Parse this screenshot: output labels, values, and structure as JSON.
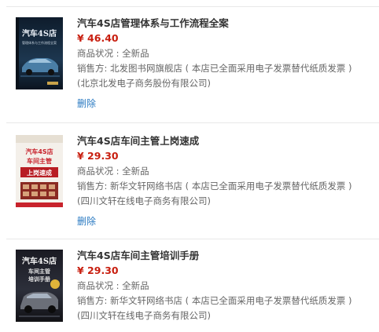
{
  "colors": {
    "price": "#c81e0f",
    "link": "#2a7ac2",
    "title": "#333333",
    "meta": "#666666"
  },
  "items": [
    {
      "cover_icon": "book-cover-car-dark",
      "title": "汽车4S店管理体系与工作流程全案",
      "price": "¥ 46.40",
      "condition": "商品状况 :  全新品",
      "seller_line": "销售方: 北发图书网旗舰店 ( 本店已全面采用电子发票替代纸质发票 )",
      "seller_company": "(北京北发电子商务股份有限公司)",
      "delete_label": "删除",
      "cover_text": {
        "t1": "汽车4S店",
        "t2": "管理体系与工作流程全案"
      }
    },
    {
      "cover_icon": "book-cover-light-red",
      "title": "汽车4S店车间主管上岗速成",
      "price": "¥ 29.30",
      "condition": "商品状况 :  全新品",
      "seller_line": "销售方: 新华文轩网络书店 ( 本店已全面采用电子发票替代纸质发票 )",
      "seller_company": "(四川文轩在线电子商务有限公司)",
      "delete_label": "删除",
      "cover_text": {
        "t1": "汽车4S店",
        "t2": "车间主管",
        "t3": "上岗速成"
      }
    },
    {
      "cover_icon": "book-cover-dark-suv",
      "title": "汽车4S店车间主管培训手册",
      "price": "¥ 29.30",
      "condition": "商品状况 :  全新品",
      "seller_line": "销售方: 新华文轩网络书店 ( 本店已全面采用电子发票替代纸质发票 )",
      "seller_company": "(四川文轩在线电子商务有限公司)",
      "cover_text": {
        "t1": "汽车4S店",
        "t2": "车间主管",
        "t3": "培训手册"
      }
    }
  ]
}
